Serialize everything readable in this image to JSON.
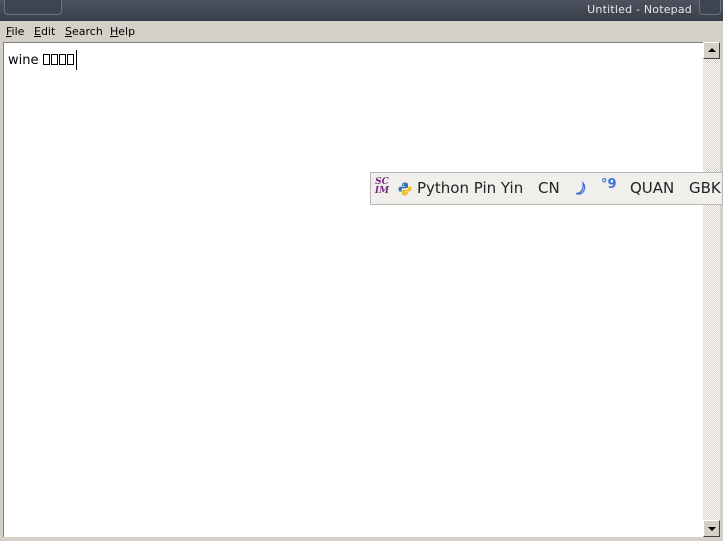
{
  "window": {
    "title": "Untitled - Notepad"
  },
  "menu": {
    "file": {
      "first": "F",
      "rest": "ile"
    },
    "edit": {
      "first": "E",
      "rest": "dit"
    },
    "search": {
      "first": "S",
      "rest": "earch"
    },
    "help": {
      "first": "H",
      "rest": "elp"
    }
  },
  "editor": {
    "text": "wine ",
    "unrenderable_glyph_count": 4
  },
  "ime_panel": {
    "logo_text_line1": "SC",
    "logo_text_line2": "IM",
    "input_method": "Python Pin Yin",
    "language_mode": "CN",
    "width_mode": "QUAN",
    "encoding": "GBK",
    "icons": [
      "scim-logo-icon",
      "python-icon",
      "moon-icon",
      "quote-icon"
    ],
    "accent_color": "#3a6fd8"
  },
  "colors": {
    "title_bar": "#3f4550",
    "menu_bg": "#d4d0c8",
    "editor_bg": "#ffffff"
  }
}
